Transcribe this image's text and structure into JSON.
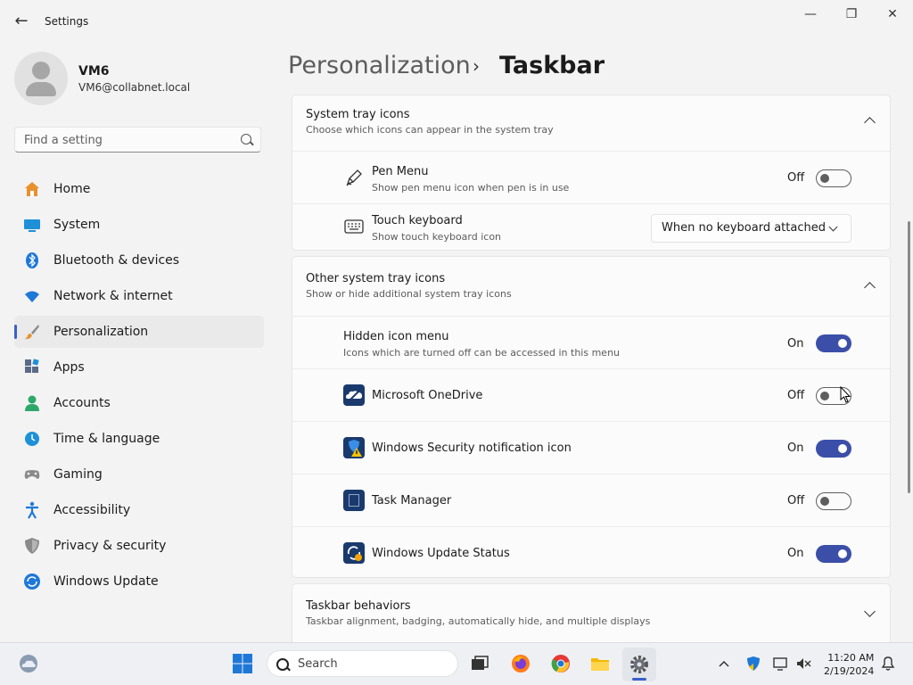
{
  "window": {
    "title": "Settings",
    "back_label": "←",
    "min_label": "—",
    "max_label": "❐",
    "close_label": "✕"
  },
  "profile": {
    "name": "VM6",
    "email": "VM6@collabnet.local"
  },
  "search": {
    "placeholder": "Find a setting"
  },
  "sidebar": {
    "items": [
      {
        "label": "Home",
        "icon": "home-icon"
      },
      {
        "label": "System",
        "icon": "system-icon"
      },
      {
        "label": "Bluetooth & devices",
        "icon": "bluetooth-icon"
      },
      {
        "label": "Network & internet",
        "icon": "wifi-icon"
      },
      {
        "label": "Personalization",
        "icon": "brush-icon",
        "active": true
      },
      {
        "label": "Apps",
        "icon": "apps-icon"
      },
      {
        "label": "Accounts",
        "icon": "accounts-icon"
      },
      {
        "label": "Time & language",
        "icon": "clock-icon"
      },
      {
        "label": "Gaming",
        "icon": "gamepad-icon"
      },
      {
        "label": "Accessibility",
        "icon": "accessibility-icon"
      },
      {
        "label": "Privacy & security",
        "icon": "shield-icon"
      },
      {
        "label": "Windows Update",
        "icon": "update-icon"
      }
    ]
  },
  "breadcrumb": {
    "parent": "Personalization",
    "separator": "›",
    "current": "Taskbar"
  },
  "system_tray": {
    "title": "System tray icons",
    "subtitle": "Choose which icons can appear in the system tray",
    "pen_menu": {
      "title": "Pen Menu",
      "subtitle": "Show pen menu icon when pen is in use",
      "state": "Off"
    },
    "touch_keyboard": {
      "title": "Touch keyboard",
      "subtitle": "Show touch keyboard icon",
      "value": "When no keyboard attached"
    }
  },
  "other_tray": {
    "title": "Other system tray icons",
    "subtitle": "Show or hide additional system tray icons",
    "hidden_menu": {
      "title": "Hidden icon menu",
      "subtitle": "Icons which are turned off can be accessed in this menu",
      "state": "On"
    },
    "items": [
      {
        "label": "Microsoft OneDrive",
        "state": "Off",
        "icon": "onedrive-icon"
      },
      {
        "label": "Windows Security notification icon",
        "state": "On",
        "icon": "windows-security-icon"
      },
      {
        "label": "Task Manager",
        "state": "Off",
        "icon": "task-manager-icon"
      },
      {
        "label": "Windows Update Status",
        "state": "On",
        "icon": "windows-update-status-icon"
      }
    ]
  },
  "taskbar_behaviors": {
    "title": "Taskbar behaviors",
    "subtitle": "Taskbar alignment, badging, automatically hide, and multiple displays"
  },
  "taskbar": {
    "search_label": "Search",
    "time": "11:20 AM",
    "date": "2/19/2024"
  },
  "colors": {
    "accent": "#3b4fa8",
    "background": "#f3f3f3",
    "card": "#fbfbfb"
  }
}
